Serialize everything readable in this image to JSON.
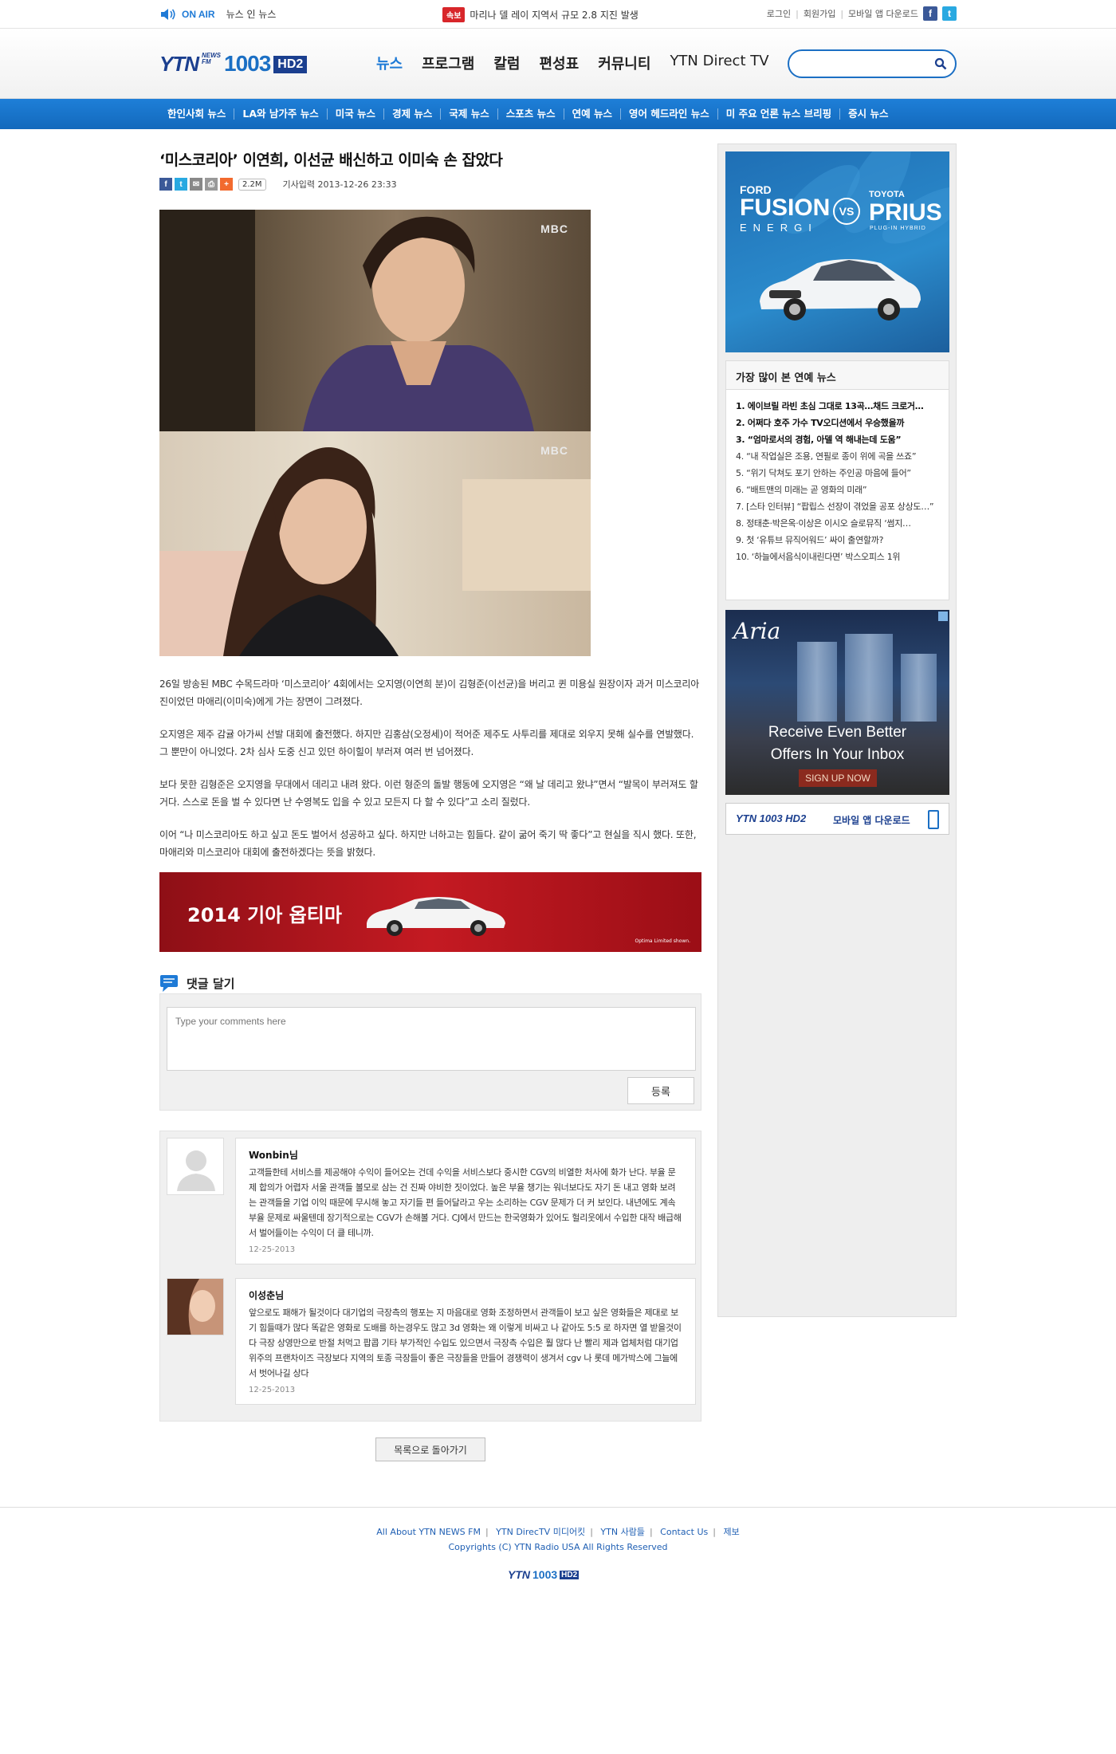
{
  "topbar": {
    "onair_label": "ON AIR",
    "live_label": "뉴스 인 뉴스",
    "breaking_tag": "속보",
    "breaking_text": "마리나 델 레이 지역서 규모 2.8 지진 발생",
    "login": "로그인",
    "signup": "회원가입",
    "mobile_app": "모바일 앱 다운로드",
    "facebook_letter": "f",
    "twitter_letter": "t"
  },
  "header": {
    "logo_ytn": "YTN",
    "logo_news": "NEWS",
    "logo_fm": "FM",
    "logo_freq": "1003",
    "logo_hd": "HD2",
    "nav": [
      "뉴스",
      "프로그램",
      "칼럼",
      "편성표",
      "커뮤니티",
      "YTN Direct TV"
    ],
    "search_placeholder": ""
  },
  "subnav": [
    "한인사회 뉴스",
    "LA와 남가주 뉴스",
    "미국 뉴스",
    "경제 뉴스",
    "국제 뉴스",
    "스포츠 뉴스",
    "연예 뉴스",
    "영어 헤드라인 뉴스",
    "미 주요 언론 뉴스 브리핑",
    "증시 뉴스"
  ],
  "article": {
    "title": "‘미스코리아’ 이연희, 이선균 배신하고 이미숙 손 잡았다",
    "share_count": "2.2M",
    "date": "기사입력 2013-12-26 23:33",
    "photo_watermark": "MBC",
    "paragraphs": [
      "26일 방송된 MBC 수목드라마 ‘미스코리아’ 4회에서는 오지영(이연희 분)이 김형준(이선균)을 버리고 퀸 미용실 원장이자 과거 미스코리아 진이었던 마애리(이미숙)에게 가는 장면이 그려졌다.",
      "오지영은 제주 감귤 아가씨 선발 대회에 출전했다. 하지만 김홍삼(오정세)이 적어준 제주도 사투리를 제대로 외우지 못해 실수를 연발했다. 그 뿐만이 아니었다. 2차 심사 도중 신고 있던 하이힐이 부러져 여러 번 넘어졌다.",
      "보다 못한 김형준은 오지영을 무대에서 데리고 내려 왔다. 이런 형준의 돌발 행동에 오지영은 “왜 날 데리고 왔냐”면서 “발목이 부러져도 할거다. 스스로 돈을 벌 수 있다면 난 수영복도 입을 수 있고 모든지 다 할 수 있다”고 소리 질렀다.",
      "이어 “나 미스코리아도 하고 싶고 돈도 벌어서 성공하고 싶다. 하지만 너하고는 힘들다. 같이 굶어 죽기 딱 좋다”고 현실을 직시 했다. 또한, 마애리와 미스코리아 대회에 출전하겠다는 뜻을 밝혔다."
    ]
  },
  "banner": {
    "text": "2014 기아 옵티마",
    "small": "Optima Limited shown."
  },
  "comment_form": {
    "title": "댓글 달기",
    "placeholder": "Type your comments here",
    "submit": "등록"
  },
  "comments": [
    {
      "name": "Wonbin님",
      "text": "고객들한테 서비스를 제공해야 수익이 들어오는 건데 수익을 서비스보다 중시한 CGV의 비열한 처사에 화가 난다. 부율 문제 합의가 어렵자 서울 관객들 볼모로 삼는 건 진짜 야비한 짓이었다. 높은 부율 챙기는 워너보다도 자기 돈 내고 영화 보려는 관객들을 기업 이익 때문에 무시해 놓고 자기들 편 들어달라고 우는 소리하는 CGV 문제가 더 커 보인다. 내년에도 계속 부율 문제로 싸울텐데 장기적으로는 CGV가 손해볼 거다. CJ에서 만드는 한국영화가 있어도 헐리웃에서 수입한 대작 배급해서 벌어들이는 수익이 더 클 테니까.",
      "date": "12-25-2013"
    },
    {
      "name": "이성춘님",
      "text": "앞으로도 패해가 될것이다 대기업의 극장측의 행포는 지 마음대로 영화 조정하면서 관객들이 보고 싶은 영화들은 제대로 보기 힘들때가 많다 똑같은 영화로 도배를 하는경우도 많고 3d 영화는 왜 이렇게 비싸고 나 같아도 5:5 로 하자면 열 받을것이다 극장 상영만으로 반절 처먹고 팝콥 기타 부가적인 수입도 있으면서 극장측 수입은 훨 많다 난 빨리 제과 업체처럼 대기업 위주의 프랜차이즈 극장보다 지역의 토종 극장들이 좋은 극장들을 만들어 경쟁력이 생겨서 cgv 나 롯데 메가박스에 그늘에서 벗어나길 상다",
      "date": "12-25-2013"
    }
  ],
  "back_button": "목록으로 돌아가기",
  "sidebar": {
    "ad1": {
      "left_line1": "FORD",
      "left_line2": "FUSION",
      "left_line3": "ENERGI",
      "vs": "VS",
      "right_line1": "TOYOTA",
      "right_line2": "PRIUS",
      "right_line3": "PLUG-IN HYBRID"
    },
    "popular_title": "가장 많이 본 연예 뉴스",
    "popular": [
      "1. 에이브릴 라빈 초심 그대로 13곡…채드 크로거…",
      "2. 어쩌다 호주 가수 TV오디션에서 우승했을까",
      "3. “엄마로서의 경험, 아델 역 해내는데 도움”",
      "4. “내 작업실은 조용, 연필로 종이 위에 곡을 쓰죠”",
      "5. “위기 닥쳐도 포기 안하는 주인공 마음에 들어”",
      "6. “배트맨의 미래는 곧 영화의 미래”",
      "7. [스타 인터뷰] “팝립스 선장이 겪었을 공포 상상도…”",
      "8. 정태춘·박은옥·이상은 이시오 슬로뮤직 ‘썸지…",
      "9. 첫 ‘유튜브 뮤직어워드’ 싸이 출연할까?",
      "10. ‘하늘에서음식이내린다면’ 박스오피스 1위"
    ],
    "ad2": {
      "brand": "Aria",
      "message_line1": "Receive Even Better",
      "message_line2": "Offers In Your Inbox",
      "cta": "SIGN UP NOW"
    },
    "mobile_label": "모바일 앱 다운로드"
  },
  "footer": {
    "links": [
      "All About YTN NEWS FM",
      "YTN DirecTV 미디어킷",
      "YTN 사람들",
      "Contact Us",
      "제보"
    ],
    "copyright": "Copyrights (C) YTN Radio USA All Rights Reserved"
  }
}
